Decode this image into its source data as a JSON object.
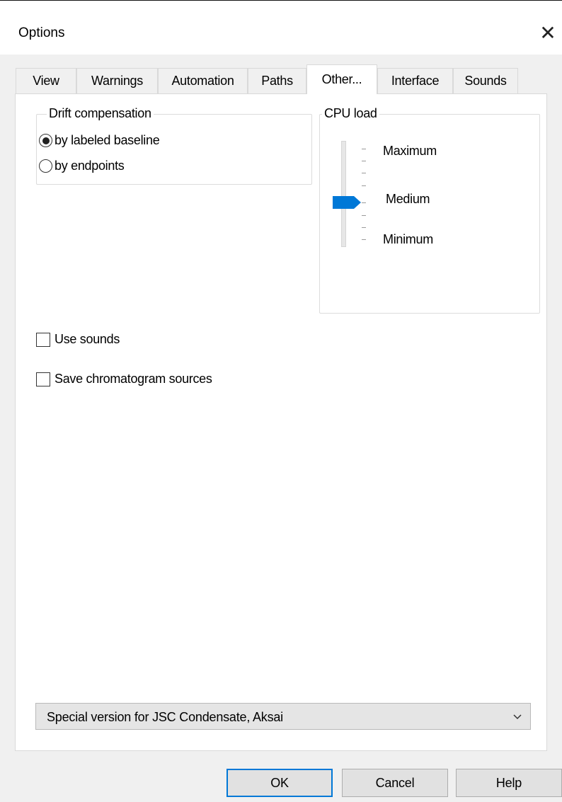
{
  "window": {
    "title": "Options",
    "close_glyph": "✕"
  },
  "tabs": [
    {
      "label": "View"
    },
    {
      "label": "Warnings"
    },
    {
      "label": "Automation"
    },
    {
      "label": "Paths"
    },
    {
      "label": "Other...",
      "active": true
    },
    {
      "label": "Interface"
    },
    {
      "label": "Sounds"
    }
  ],
  "drift": {
    "legend": "Drift compensation",
    "options": [
      {
        "label": "by labeled baseline",
        "selected": true
      },
      {
        "label": "by endpoints",
        "selected": false
      }
    ]
  },
  "cpu": {
    "legend": "CPU load",
    "levels": {
      "max": "Maximum",
      "mid": "Medium",
      "min": "Minimum"
    },
    "value": "Medium",
    "thumb_color": "#0078d7"
  },
  "checkboxes": {
    "use_sounds": {
      "label": "Use sounds",
      "checked": false
    },
    "save_sources": {
      "label": "Save chromatogram sources",
      "checked": false
    }
  },
  "version_select": {
    "value": "Special version for JSC Condensate, Aksai"
  },
  "buttons": {
    "ok": "OK",
    "cancel": "Cancel",
    "help": "Help"
  },
  "colors": {
    "accent": "#0078d7"
  }
}
